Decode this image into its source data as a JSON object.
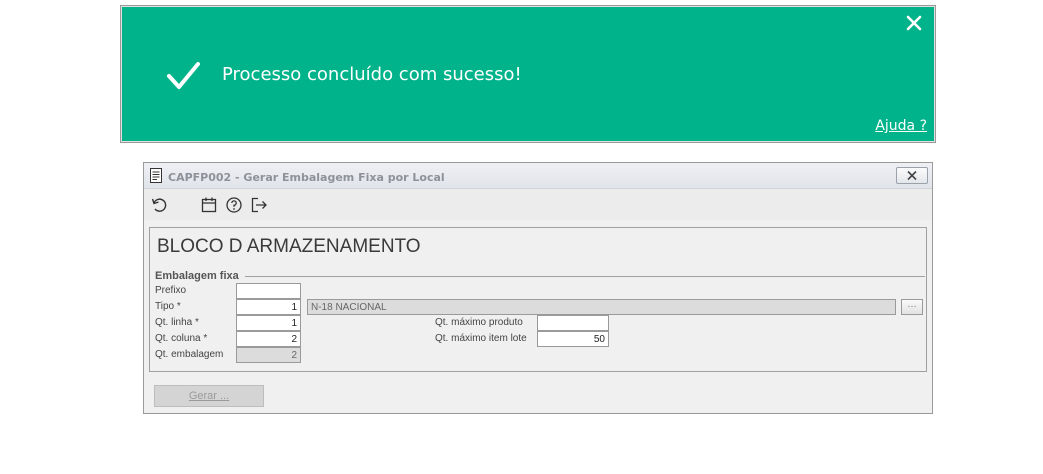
{
  "toast": {
    "message": "Processo concluído com sucesso!",
    "help_link": "Ajuda ?",
    "close_icon": "close-icon",
    "check_icon": "checkmark-icon",
    "color": "#00b38a"
  },
  "window": {
    "title": "CAPFP002 - Gerar Embalagem Fixa por Local",
    "toolbar": [
      "refresh-icon",
      "calendar-icon",
      "help-icon",
      "exit-icon"
    ]
  },
  "form": {
    "block_title": "BLOCO D ARMAZENAMENTO",
    "group_label": "Embalagem fixa",
    "fields": {
      "prefixo": {
        "label": "Prefixo",
        "value": ""
      },
      "tipo": {
        "label": "Tipo *",
        "value": "1",
        "desc": "N-18 NACIONAL"
      },
      "qt_linha": {
        "label": "Qt. linha *",
        "value": "1"
      },
      "qt_coluna": {
        "label": "Qt. coluna *",
        "value": "2"
      },
      "qt_embalagem": {
        "label": "Qt. embalagem",
        "value": "2"
      },
      "qt_max_produto": {
        "label": "Qt. máximo produto",
        "value": ""
      },
      "qt_max_item_lote": {
        "label": "Qt. máximo item lote",
        "value": "50"
      }
    },
    "gerar_label": "Gerar ..."
  }
}
